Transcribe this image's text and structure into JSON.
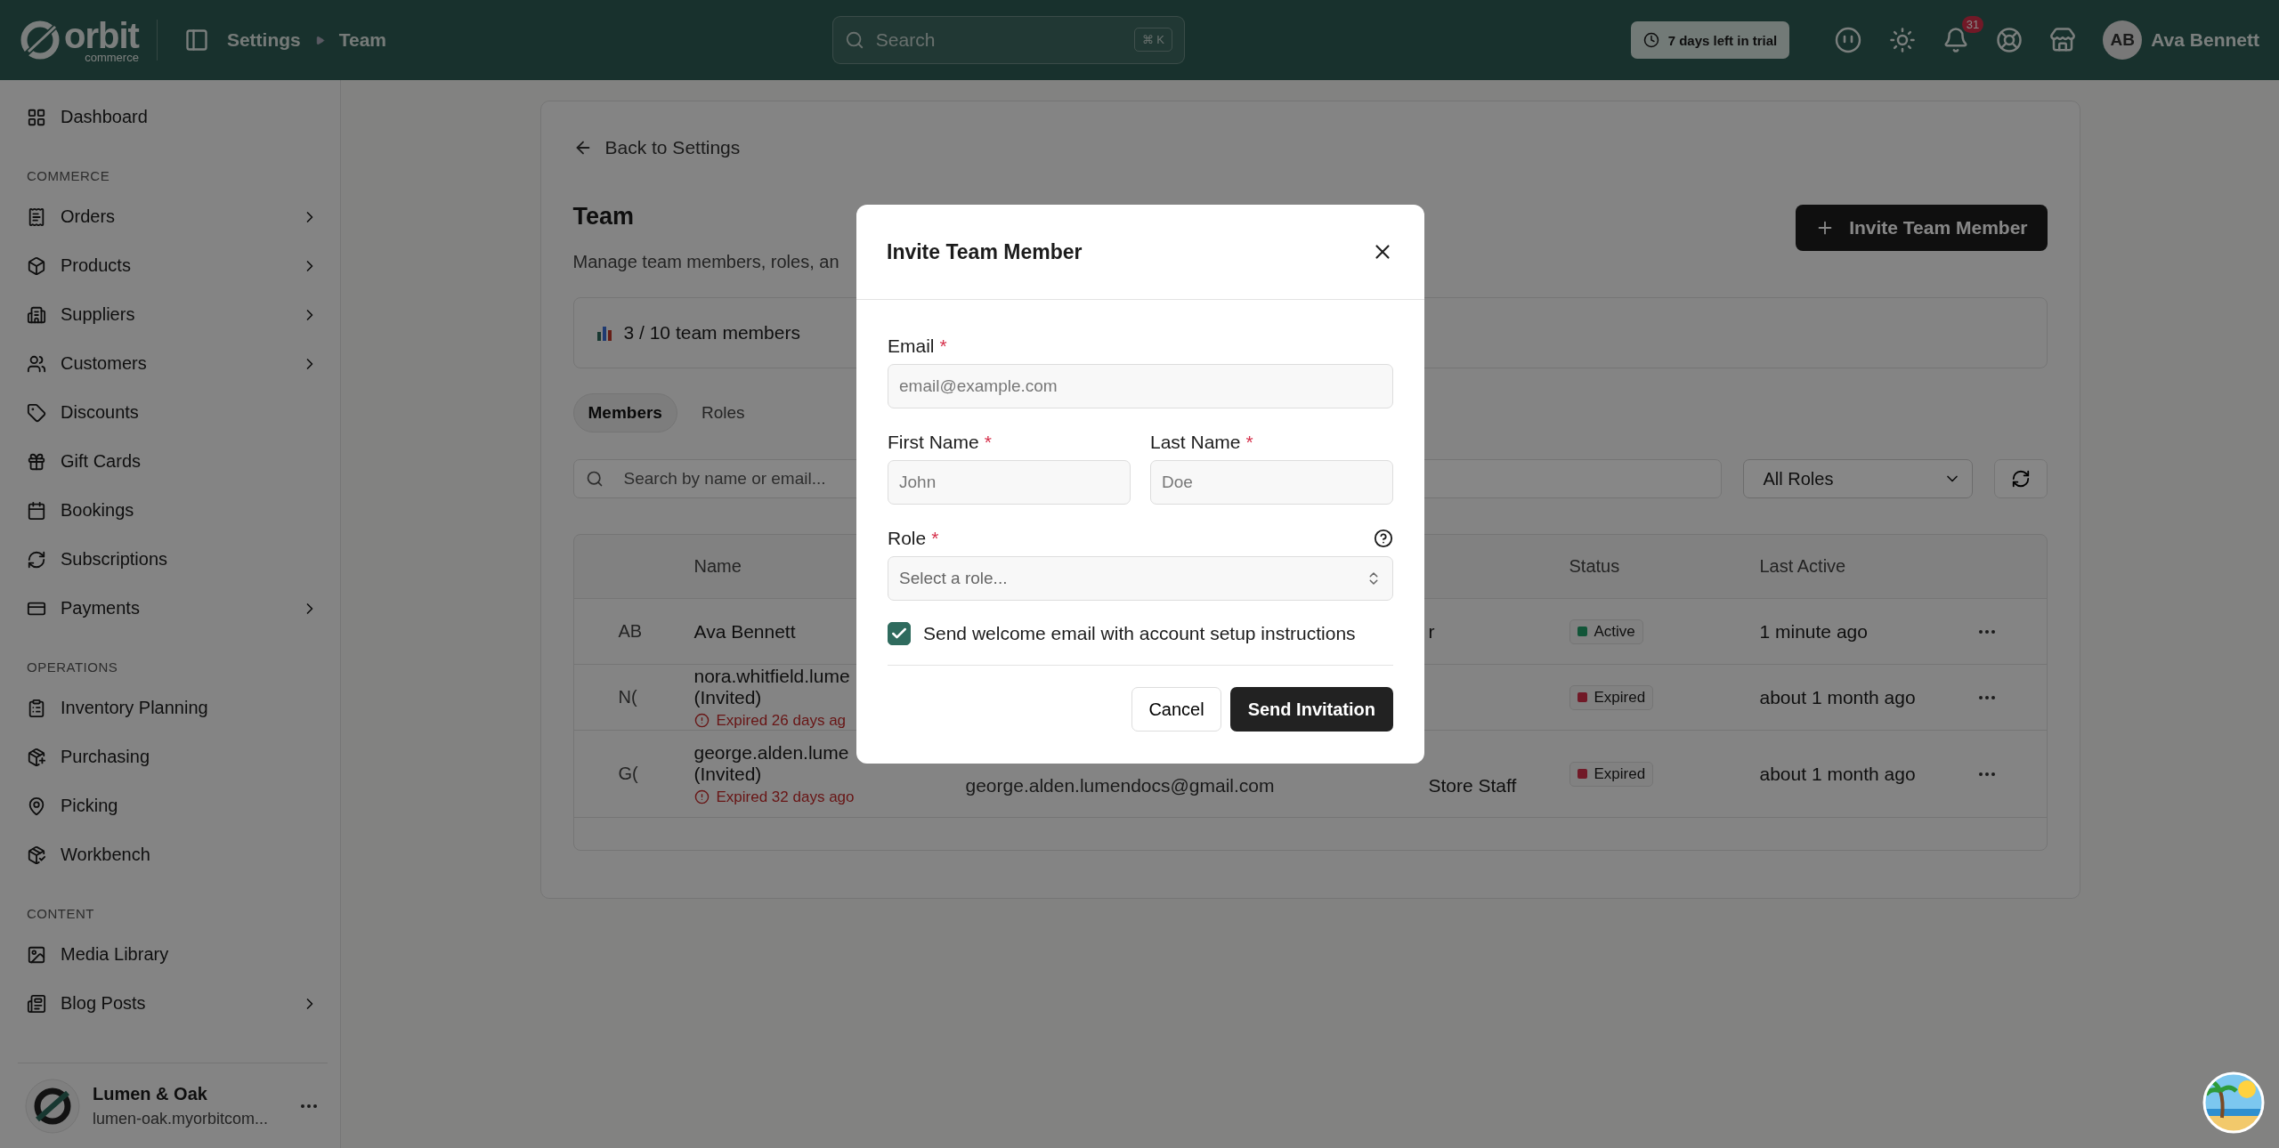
{
  "header": {
    "logo": {
      "wordmark": "orbit",
      "tagline": "commerce"
    },
    "breadcrumb": [
      "Settings",
      "Team"
    ],
    "search": {
      "placeholder": "Search",
      "shortcut": "⌘ K"
    },
    "trial_badge": "7 days left in trial",
    "notifications_count": "31",
    "user": {
      "initials": "AB",
      "name": "Ava Bennett"
    }
  },
  "sidebar": {
    "groups": [
      {
        "items": [
          {
            "label": "Dashboard",
            "has_children": false
          }
        ]
      },
      {
        "heading": "COMMERCE",
        "items": [
          {
            "label": "Orders",
            "has_children": true
          },
          {
            "label": "Products",
            "has_children": true
          },
          {
            "label": "Suppliers",
            "has_children": true
          },
          {
            "label": "Customers",
            "has_children": true
          },
          {
            "label": "Discounts",
            "has_children": false
          },
          {
            "label": "Gift Cards",
            "has_children": false
          },
          {
            "label": "Bookings",
            "has_children": false
          },
          {
            "label": "Subscriptions",
            "has_children": false
          },
          {
            "label": "Payments",
            "has_children": true
          }
        ]
      },
      {
        "heading": "OPERATIONS",
        "items": [
          {
            "label": "Inventory Planning",
            "has_children": false
          },
          {
            "label": "Purchasing",
            "has_children": false
          },
          {
            "label": "Picking",
            "has_children": false
          },
          {
            "label": "Workbench",
            "has_children": false
          }
        ]
      },
      {
        "heading": "CONTENT",
        "items": [
          {
            "label": "Media Library",
            "has_children": false
          },
          {
            "label": "Blog Posts",
            "has_children": true
          }
        ]
      }
    ],
    "store": {
      "name": "Lumen & Oak",
      "domain": "lumen-oak.myorbitcom..."
    }
  },
  "page": {
    "back_link": "Back to Settings",
    "title": "Team",
    "subtitle": "Manage team members, roles, an",
    "invite_button": "Invite Team Member",
    "usage": "3 / 10 team members",
    "tabs": [
      {
        "label": "Members",
        "selected": true
      },
      {
        "label": "Roles",
        "selected": false
      }
    ],
    "search": {
      "placeholder": "Search by name or email..."
    },
    "role_filter": "All Roles",
    "table": {
      "columns": [
        "Name",
        "Status",
        "Last Active"
      ],
      "rows": [
        {
          "initials": "AB",
          "name": "Ava Bennett",
          "role": "r",
          "status": {
            "label": "Active",
            "kind": "active"
          },
          "last_active": "1 minute ago"
        },
        {
          "initials": "N(",
          "name": "nora.whitfield.lume",
          "invited": "(Invited)",
          "expiry": "Expired 26 days ag",
          "status": {
            "label": "Expired",
            "kind": "expired"
          },
          "last_active": "about 1 month ago"
        },
        {
          "initials": "G(",
          "name": "george.alden.lume",
          "invited": "(Invited)",
          "expiry": "Expired 32 days ago",
          "email": "george.alden.lumendocs@gmail.com",
          "role": "Store Staff",
          "status": {
            "label": "Expired",
            "kind": "expired"
          },
          "last_active": "about 1 month ago"
        }
      ]
    }
  },
  "dialog": {
    "title": "Invite Team Member",
    "email": {
      "label": "Email",
      "marker": "*",
      "placeholder": "email@example.com"
    },
    "first_name": {
      "label": "First Name",
      "marker": "*",
      "placeholder": "John"
    },
    "last_name": {
      "label": "Last Name",
      "marker": "*",
      "placeholder": "Doe"
    },
    "role": {
      "label": "Role",
      "marker": "*",
      "placeholder": "Select a role..."
    },
    "welcome_email": {
      "label": "Send welcome email with account setup instructions",
      "checked": true
    },
    "buttons": {
      "cancel": "Cancel",
      "submit": "Send Invitation"
    }
  }
}
